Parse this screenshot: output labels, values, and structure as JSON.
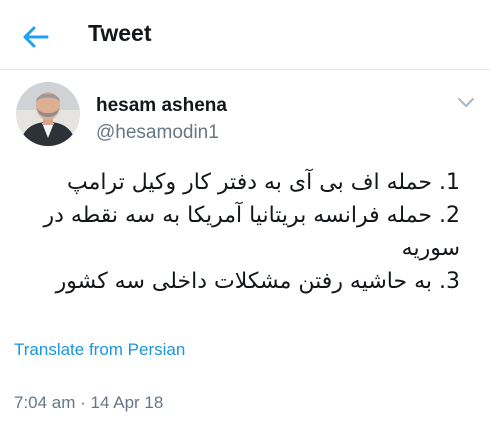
{
  "header": {
    "title": "Tweet",
    "back_icon": "arrow-left-icon"
  },
  "author": {
    "name": "hesam ashena",
    "handle": "@hesamodin1"
  },
  "tweet": {
    "line1": "1. حمله اف بی آی به دفتر کار وکیل ترامپ",
    "line2": "2. حمله فرانسه بریتانیا آمریکا  به سه نقطه در",
    "line3": "سوریه",
    "line4": "3. به حاشیه رفتن مشکلات داخلی سه کشور"
  },
  "translate_label": "Translate from Persian",
  "timestamp": "7:04 am · 14 Apr 18",
  "colors": {
    "accent": "#1b95e0",
    "text": "#14171a",
    "secondary": "#657786",
    "divider": "#e1e8ed"
  }
}
